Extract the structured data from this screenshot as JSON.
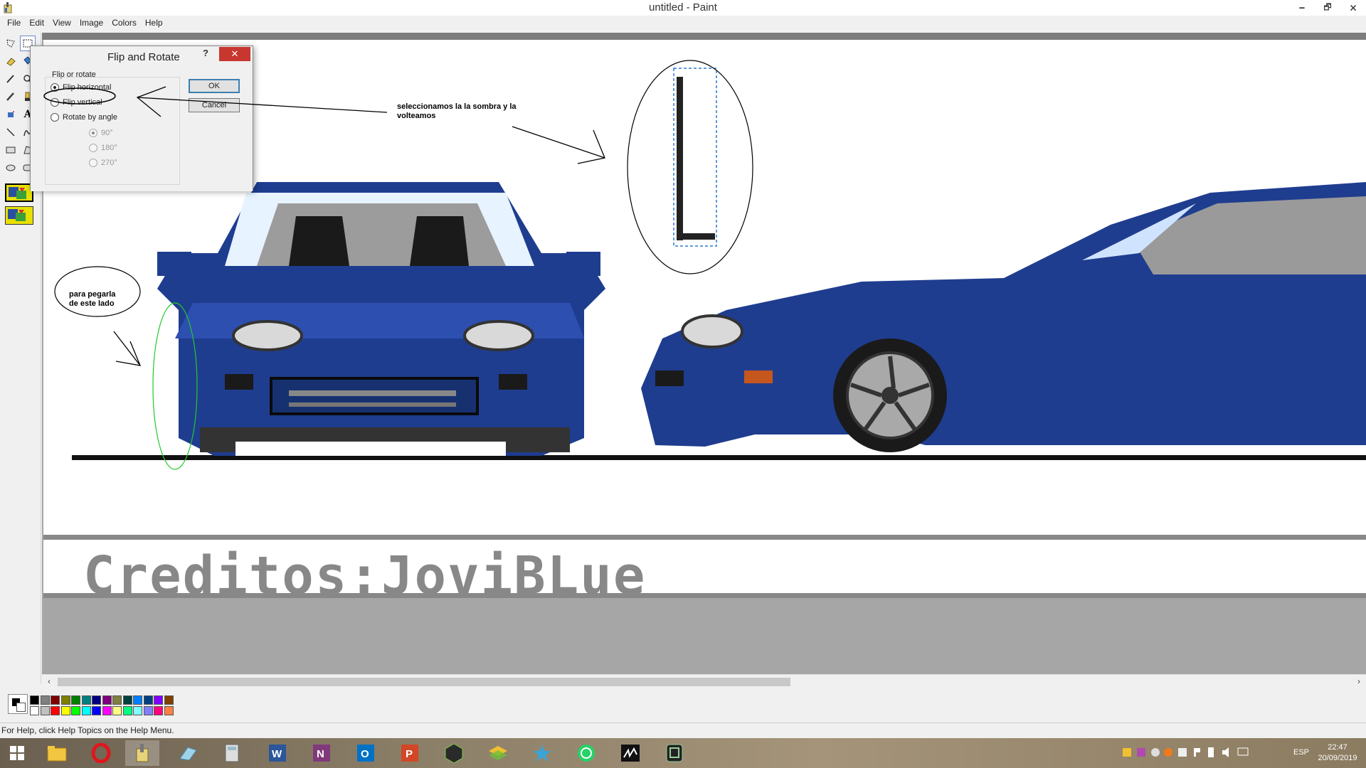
{
  "window": {
    "title": "untitled - Paint",
    "controls": [
      "🗕",
      "🗗",
      "🗙"
    ]
  },
  "menu": [
    "File",
    "Edit",
    "View",
    "Image",
    "Colors",
    "Help"
  ],
  "canvas": {
    "credit": "Creditos:JoviBLue"
  },
  "dialog": {
    "title": "Flip and Rotate",
    "help": "?",
    "close": "✕",
    "group_label": "Flip or rotate",
    "options": [
      {
        "label": "Flip horizontal",
        "checked": true,
        "disabled": false
      },
      {
        "label": "Flip vertical",
        "checked": false,
        "disabled": false
      },
      {
        "label": "Rotate by angle",
        "checked": false,
        "disabled": false
      }
    ],
    "angles": [
      {
        "label": "90°",
        "checked": true
      },
      {
        "label": "180°",
        "checked": false
      },
      {
        "label": "270°",
        "checked": false
      }
    ],
    "ok": "OK",
    "cancel": "Cancel"
  },
  "annotations": {
    "shadow_note_line1": "seleccionamos la la sombra y la",
    "shadow_note_line2": "volteamos",
    "paste_note_line1": "para pegarla",
    "paste_note_line2": "de este lado"
  },
  "palette": {
    "top_row": [
      "#000000",
      "#808080",
      "#800000",
      "#808000",
      "#008000",
      "#008080",
      "#000080",
      "#800080",
      "#808040",
      "#004040",
      "#0080ff",
      "#004080",
      "#8000ff",
      "#804000"
    ],
    "bottom_row": [
      "#ffffff",
      "#c0c0c0",
      "#ff0000",
      "#ffff00",
      "#00ff00",
      "#00ffff",
      "#0000ff",
      "#ff00ff",
      "#ffff80",
      "#00ff80",
      "#80ffff",
      "#8080ff",
      "#ff0080",
      "#ff8040"
    ]
  },
  "statusbar": {
    "text": "For Help, click Help Topics on the Help Menu."
  },
  "taskbar": {
    "apps": [
      "windows-start",
      "file-explorer",
      "opera",
      "paint",
      "eraser-app",
      "calculator",
      "word",
      "onenote",
      "outlook",
      "powerpoint",
      "nox",
      "bluestacks",
      "app-star",
      "whatsapp",
      "signature-app",
      "device-app"
    ],
    "tray": {
      "language": "ESP",
      "time": "22:47",
      "date": "20/09/2019"
    }
  }
}
